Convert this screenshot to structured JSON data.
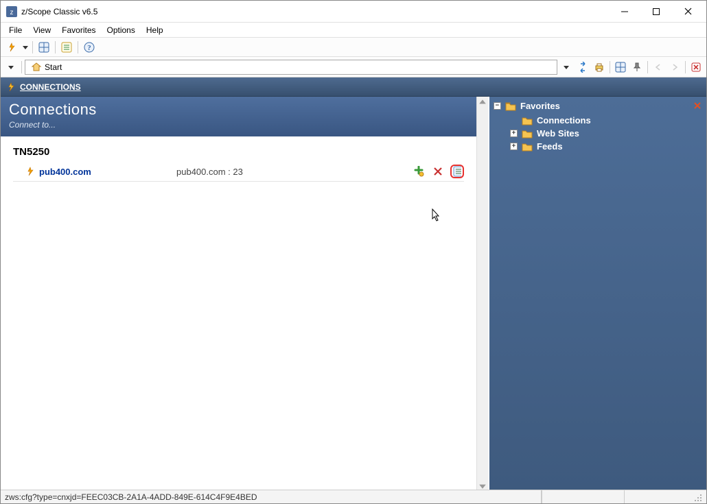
{
  "window": {
    "title": "z/Scope Classic v6.5"
  },
  "menu": {
    "items": [
      "File",
      "View",
      "Favorites",
      "Options",
      "Help"
    ]
  },
  "toolbar2": {
    "start_label": "Start"
  },
  "tabstrip": {
    "label": "CONNECTIONS"
  },
  "connections": {
    "header_title": "Connections",
    "header_subtitle": "Connect to...",
    "group_title": "TN5250",
    "items": [
      {
        "name": "pub400.com",
        "host": "pub400.com : 23"
      }
    ]
  },
  "favorites": {
    "root_label": "Favorites",
    "children": [
      {
        "label": "Connections",
        "expandable": false
      },
      {
        "label": "Web Sites",
        "expandable": true
      },
      {
        "label": "Feeds",
        "expandable": true
      }
    ]
  },
  "statusbar": {
    "text": "zws:cfg?type=cnxjd=FEEC03CB-2A1A-4ADD-849E-614C4F9E4BED"
  }
}
